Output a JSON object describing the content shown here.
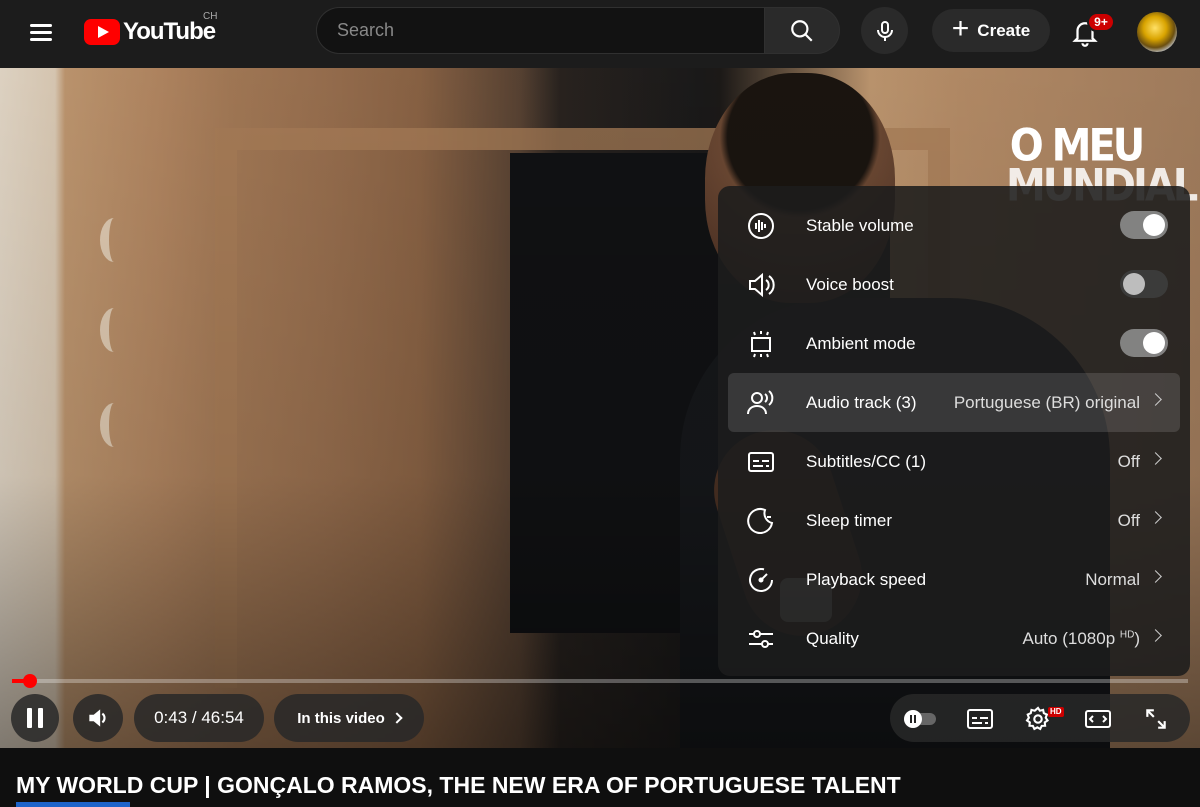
{
  "header": {
    "logo_text": "YouTube",
    "country_code": "CH",
    "search_placeholder": "Search",
    "create_label": "Create",
    "notification_badge": "9+"
  },
  "video": {
    "overlay_text_line1": "O MEU",
    "overlay_text_line2": "MUNDIAL"
  },
  "settings_menu": {
    "items": [
      {
        "label": "Stable volume",
        "icon": "stable-volume-icon",
        "toggle": true
      },
      {
        "label": "Voice boost",
        "icon": "voice-boost-icon",
        "toggle": false
      },
      {
        "label": "Ambient mode",
        "icon": "ambient-mode-icon",
        "toggle": true
      },
      {
        "label": "Audio track (3)",
        "icon": "audio-track-icon",
        "value": "Portuguese (BR) original"
      },
      {
        "label": "Subtitles/CC (1)",
        "icon": "subtitles-icon",
        "value": "Off"
      },
      {
        "label": "Sleep timer",
        "icon": "sleep-timer-icon",
        "value": "Off"
      },
      {
        "label": "Playback speed",
        "icon": "playback-speed-icon",
        "value": "Normal"
      },
      {
        "label": "Quality",
        "icon": "quality-icon",
        "value": "Auto (1080p ",
        "value_sup": "HD",
        "value_suffix": ")"
      }
    ]
  },
  "player": {
    "time_display": "0:43 / 46:54",
    "chapters_label": "In this video",
    "progress_fraction": 0.0153,
    "accent_color": "#ff0000",
    "hd_badge": "HD"
  },
  "title": "MY WORLD CUP | GONÇALO RAMOS, THE NEW ERA OF PORTUGUESE TALENT"
}
